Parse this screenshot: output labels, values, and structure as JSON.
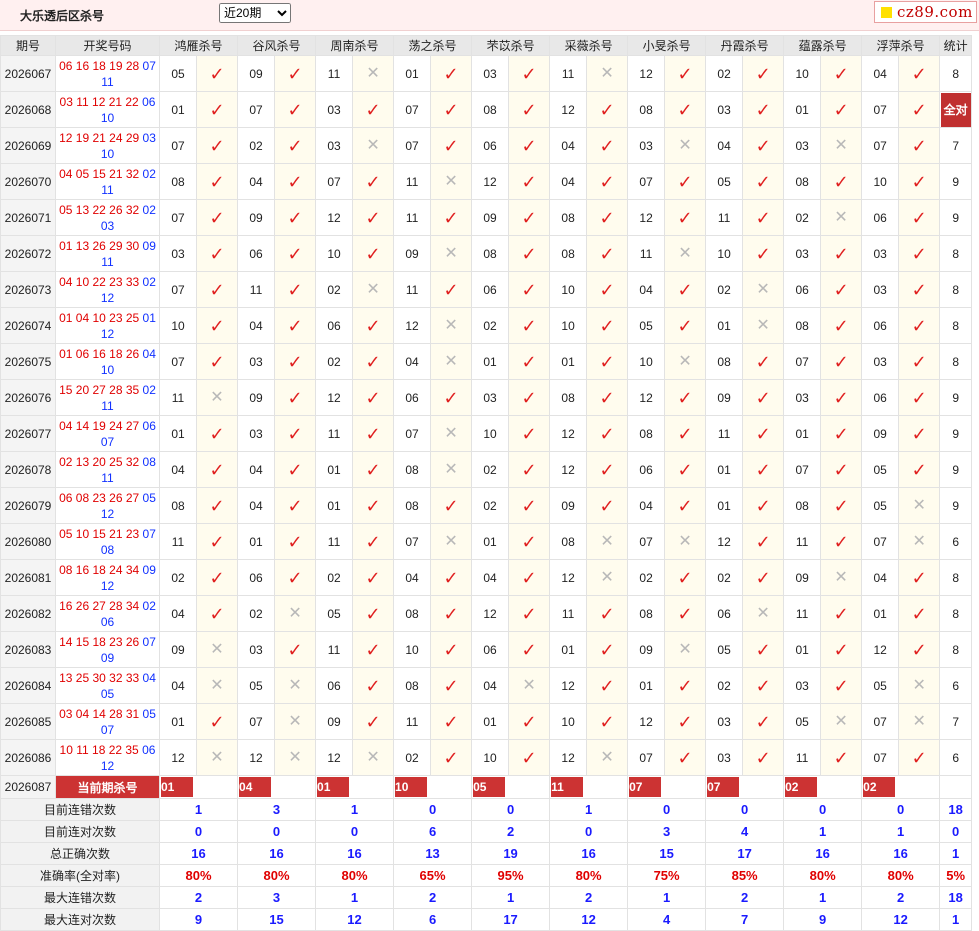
{
  "header": {
    "title": "大乐透后区杀号",
    "period_select": "近20期",
    "logo_text": "cz89.com"
  },
  "columns": {
    "issue": "期号",
    "draw": "开奖号码",
    "experts": [
      "鸿雁杀号",
      "谷风杀号",
      "周南杀号",
      "荡之杀号",
      "芣苡杀号",
      "采薇杀号",
      "小旻杀号",
      "丹霞杀号",
      "蕴露杀号",
      "浮萍杀号"
    ],
    "stats": "统计"
  },
  "rows": [
    {
      "issue": "2026067",
      "front": "06 16 18 19 28",
      "back1": "07",
      "back2": "11",
      "kills": [
        [
          "05",
          1
        ],
        [
          "09",
          1
        ],
        [
          "11",
          0
        ],
        [
          "01",
          1
        ],
        [
          "03",
          1
        ],
        [
          "11",
          0
        ],
        [
          "12",
          1
        ],
        [
          "02",
          1
        ],
        [
          "10",
          1
        ],
        [
          "04",
          1
        ]
      ],
      "count": "8"
    },
    {
      "issue": "2026068",
      "front": "03 11 12 21 22",
      "back1": "06",
      "back2": "10",
      "kills": [
        [
          "01",
          1
        ],
        [
          "07",
          1
        ],
        [
          "03",
          1
        ],
        [
          "07",
          1
        ],
        [
          "08",
          1
        ],
        [
          "12",
          1
        ],
        [
          "08",
          1
        ],
        [
          "03",
          1
        ],
        [
          "01",
          1
        ],
        [
          "07",
          1
        ]
      ],
      "count": "全对"
    },
    {
      "issue": "2026069",
      "front": "12 19 21 24 29",
      "back1": "03",
      "back2": "10",
      "kills": [
        [
          "07",
          1
        ],
        [
          "02",
          1
        ],
        [
          "03",
          0
        ],
        [
          "07",
          1
        ],
        [
          "06",
          1
        ],
        [
          "04",
          1
        ],
        [
          "03",
          0
        ],
        [
          "04",
          1
        ],
        [
          "03",
          0
        ],
        [
          "07",
          1
        ]
      ],
      "count": "7"
    },
    {
      "issue": "2026070",
      "front": "04 05 15 21 32",
      "back1": "02",
      "back2": "11",
      "kills": [
        [
          "08",
          1
        ],
        [
          "04",
          1
        ],
        [
          "07",
          1
        ],
        [
          "11",
          0
        ],
        [
          "12",
          1
        ],
        [
          "04",
          1
        ],
        [
          "07",
          1
        ],
        [
          "05",
          1
        ],
        [
          "08",
          1
        ],
        [
          "10",
          1
        ]
      ],
      "count": "9"
    },
    {
      "issue": "2026071",
      "front": "05 13 22 26 32",
      "back1": "02",
      "back2": "03",
      "kills": [
        [
          "07",
          1
        ],
        [
          "09",
          1
        ],
        [
          "12",
          1
        ],
        [
          "11",
          1
        ],
        [
          "09",
          1
        ],
        [
          "08",
          1
        ],
        [
          "12",
          1
        ],
        [
          "11",
          1
        ],
        [
          "02",
          0
        ],
        [
          "06",
          1
        ]
      ],
      "count": "9"
    },
    {
      "issue": "2026072",
      "front": "01 13 26 29 30",
      "back1": "09",
      "back2": "11",
      "kills": [
        [
          "03",
          1
        ],
        [
          "06",
          1
        ],
        [
          "10",
          1
        ],
        [
          "09",
          0
        ],
        [
          "08",
          1
        ],
        [
          "08",
          1
        ],
        [
          "11",
          0
        ],
        [
          "10",
          1
        ],
        [
          "03",
          1
        ],
        [
          "03",
          1
        ]
      ],
      "count": "8"
    },
    {
      "issue": "2026073",
      "front": "04 10 22 23 33",
      "back1": "02",
      "back2": "12",
      "kills": [
        [
          "07",
          1
        ],
        [
          "11",
          1
        ],
        [
          "02",
          0
        ],
        [
          "11",
          1
        ],
        [
          "06",
          1
        ],
        [
          "10",
          1
        ],
        [
          "04",
          1
        ],
        [
          "02",
          0
        ],
        [
          "06",
          1
        ],
        [
          "03",
          1
        ]
      ],
      "count": "8"
    },
    {
      "issue": "2026074",
      "front": "01 04 10 23 25",
      "back1": "01",
      "back2": "12",
      "kills": [
        [
          "10",
          1
        ],
        [
          "04",
          1
        ],
        [
          "06",
          1
        ],
        [
          "12",
          0
        ],
        [
          "02",
          1
        ],
        [
          "10",
          1
        ],
        [
          "05",
          1
        ],
        [
          "01",
          0
        ],
        [
          "08",
          1
        ],
        [
          "06",
          1
        ]
      ],
      "count": "8"
    },
    {
      "issue": "2026075",
      "front": "01 06 16 18 26",
      "back1": "04",
      "back2": "10",
      "kills": [
        [
          "07",
          1
        ],
        [
          "03",
          1
        ],
        [
          "02",
          1
        ],
        [
          "04",
          0
        ],
        [
          "01",
          1
        ],
        [
          "01",
          1
        ],
        [
          "10",
          0
        ],
        [
          "08",
          1
        ],
        [
          "07",
          1
        ],
        [
          "03",
          1
        ]
      ],
      "count": "8"
    },
    {
      "issue": "2026076",
      "front": "15 20 27 28 35",
      "back1": "02",
      "back2": "11",
      "kills": [
        [
          "11",
          0
        ],
        [
          "09",
          1
        ],
        [
          "12",
          1
        ],
        [
          "06",
          1
        ],
        [
          "03",
          1
        ],
        [
          "08",
          1
        ],
        [
          "12",
          1
        ],
        [
          "09",
          1
        ],
        [
          "03",
          1
        ],
        [
          "06",
          1
        ]
      ],
      "count": "9"
    },
    {
      "issue": "2026077",
      "front": "04 14 19 24 27",
      "back1": "06",
      "back2": "07",
      "kills": [
        [
          "01",
          1
        ],
        [
          "03",
          1
        ],
        [
          "11",
          1
        ],
        [
          "07",
          0
        ],
        [
          "10",
          1
        ],
        [
          "12",
          1
        ],
        [
          "08",
          1
        ],
        [
          "11",
          1
        ],
        [
          "01",
          1
        ],
        [
          "09",
          1
        ]
      ],
      "count": "9"
    },
    {
      "issue": "2026078",
      "front": "02 13 20 25 32",
      "back1": "08",
      "back2": "11",
      "kills": [
        [
          "04",
          1
        ],
        [
          "04",
          1
        ],
        [
          "01",
          1
        ],
        [
          "08",
          0
        ],
        [
          "02",
          1
        ],
        [
          "12",
          1
        ],
        [
          "06",
          1
        ],
        [
          "01",
          1
        ],
        [
          "07",
          1
        ],
        [
          "05",
          1
        ]
      ],
      "count": "9"
    },
    {
      "issue": "2026079",
      "front": "06 08 23 26 27",
      "back1": "05",
      "back2": "12",
      "kills": [
        [
          "08",
          1
        ],
        [
          "04",
          1
        ],
        [
          "01",
          1
        ],
        [
          "08",
          1
        ],
        [
          "02",
          1
        ],
        [
          "09",
          1
        ],
        [
          "04",
          1
        ],
        [
          "01",
          1
        ],
        [
          "08",
          1
        ],
        [
          "05",
          0
        ]
      ],
      "count": "9"
    },
    {
      "issue": "2026080",
      "front": "05 10 15 21 23",
      "back1": "07",
      "back2": "08",
      "kills": [
        [
          "11",
          1
        ],
        [
          "01",
          1
        ],
        [
          "11",
          1
        ],
        [
          "07",
          0
        ],
        [
          "01",
          1
        ],
        [
          "08",
          0
        ],
        [
          "07",
          0
        ],
        [
          "12",
          1
        ],
        [
          "11",
          1
        ],
        [
          "07",
          0
        ]
      ],
      "count": "6"
    },
    {
      "issue": "2026081",
      "front": "08 16 18 24 34",
      "back1": "09",
      "back2": "12",
      "kills": [
        [
          "02",
          1
        ],
        [
          "06",
          1
        ],
        [
          "02",
          1
        ],
        [
          "04",
          1
        ],
        [
          "04",
          1
        ],
        [
          "12",
          0
        ],
        [
          "02",
          1
        ],
        [
          "02",
          1
        ],
        [
          "09",
          0
        ],
        [
          "04",
          1
        ]
      ],
      "count": "8"
    },
    {
      "issue": "2026082",
      "front": "16 26 27 28 34",
      "back1": "02",
      "back2": "06",
      "kills": [
        [
          "04",
          1
        ],
        [
          "02",
          0
        ],
        [
          "05",
          1
        ],
        [
          "08",
          1
        ],
        [
          "12",
          1
        ],
        [
          "11",
          1
        ],
        [
          "08",
          1
        ],
        [
          "06",
          0
        ],
        [
          "11",
          1
        ],
        [
          "01",
          1
        ]
      ],
      "count": "8"
    },
    {
      "issue": "2026083",
      "front": "14 15 18 23 26",
      "back1": "07",
      "back2": "09",
      "kills": [
        [
          "09",
          0
        ],
        [
          "03",
          1
        ],
        [
          "11",
          1
        ],
        [
          "10",
          1
        ],
        [
          "06",
          1
        ],
        [
          "01",
          1
        ],
        [
          "09",
          0
        ],
        [
          "05",
          1
        ],
        [
          "01",
          1
        ],
        [
          "12",
          1
        ]
      ],
      "count": "8"
    },
    {
      "issue": "2026084",
      "front": "13 25 30 32 33",
      "back1": "04",
      "back2": "05",
      "kills": [
        [
          "04",
          0
        ],
        [
          "05",
          0
        ],
        [
          "06",
          1
        ],
        [
          "08",
          1
        ],
        [
          "04",
          0
        ],
        [
          "12",
          1
        ],
        [
          "01",
          1
        ],
        [
          "02",
          1
        ],
        [
          "03",
          1
        ],
        [
          "05",
          0
        ]
      ],
      "count": "6"
    },
    {
      "issue": "2026085",
      "front": "03 04 14 28 31",
      "back1": "05",
      "back2": "07",
      "kills": [
        [
          "01",
          1
        ],
        [
          "07",
          0
        ],
        [
          "09",
          1
        ],
        [
          "11",
          1
        ],
        [
          "01",
          1
        ],
        [
          "10",
          1
        ],
        [
          "12",
          1
        ],
        [
          "03",
          1
        ],
        [
          "05",
          0
        ],
        [
          "07",
          0
        ]
      ],
      "count": "7"
    },
    {
      "issue": "2026086",
      "front": "10 11 18 22 35",
      "back1": "06",
      "back2": "12",
      "kills": [
        [
          "12",
          0
        ],
        [
          "12",
          0
        ],
        [
          "12",
          0
        ],
        [
          "02",
          1
        ],
        [
          "10",
          1
        ],
        [
          "12",
          0
        ],
        [
          "07",
          1
        ],
        [
          "03",
          1
        ],
        [
          "11",
          1
        ],
        [
          "07",
          1
        ]
      ],
      "count": "6"
    }
  ],
  "current": {
    "issue": "2026087",
    "label": "当前期杀号",
    "kills": [
      "01",
      "04",
      "01",
      "10",
      "05",
      "11",
      "07",
      "07",
      "02",
      "02"
    ]
  },
  "summary": [
    {
      "label": "目前连错次数",
      "values": [
        "1",
        "3",
        "1",
        "0",
        "0",
        "1",
        "0",
        "0",
        "0",
        "0"
      ],
      "total": "18"
    },
    {
      "label": "目前连对次数",
      "values": [
        "0",
        "0",
        "0",
        "6",
        "2",
        "0",
        "3",
        "4",
        "1",
        "1"
      ],
      "total": "0"
    },
    {
      "label": "总正确次数",
      "values": [
        "16",
        "16",
        "16",
        "13",
        "19",
        "16",
        "15",
        "17",
        "16",
        "16"
      ],
      "total": "1"
    },
    {
      "label": "准确率(全对率)",
      "values": [
        "80%",
        "80%",
        "80%",
        "65%",
        "95%",
        "80%",
        "75%",
        "85%",
        "80%",
        "80%"
      ],
      "total": "5%",
      "is_rate": true
    },
    {
      "label": "最大连错次数",
      "values": [
        "2",
        "3",
        "1",
        "2",
        "1",
        "2",
        "1",
        "2",
        "1",
        "2"
      ],
      "total": "18"
    },
    {
      "label": "最大连对次数",
      "values": [
        "9",
        "15",
        "12",
        "6",
        "17",
        "12",
        "4",
        "7",
        "9",
        "12"
      ],
      "total": "1"
    }
  ]
}
